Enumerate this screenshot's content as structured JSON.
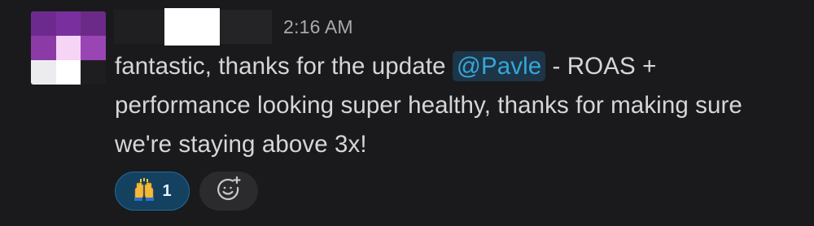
{
  "message": {
    "timestamp": "2:16 AM",
    "text_before": "fantastic, thanks for the update ",
    "mention": "@Pavle",
    "text_after": " - ROAS + performance looking super healthy, thanks for making sure we're staying above 3x!"
  },
  "reactions": [
    {
      "emoji": "🙌",
      "emoji_name": "raised-hands",
      "count": "1"
    }
  ],
  "add_reaction": {
    "icon": "add-emoji-icon"
  },
  "colors": {
    "background": "#1a1a1c",
    "mention_text": "#36a6d9",
    "mention_bg": "#1d3547",
    "reaction_bg": "#14415f",
    "reaction_border": "#1f6d9c"
  }
}
